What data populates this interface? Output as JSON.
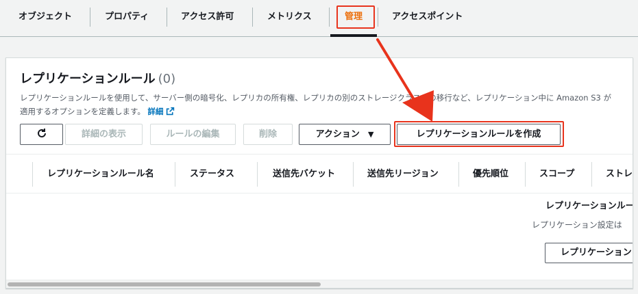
{
  "tabs": {
    "items": [
      {
        "label": "オブジェクト"
      },
      {
        "label": "プロパティ"
      },
      {
        "label": "アクセス許可"
      },
      {
        "label": "メトリクス"
      },
      {
        "label": "管理"
      },
      {
        "label": "アクセスポイント"
      }
    ],
    "active_index": 4
  },
  "panel": {
    "title": "レプリケーションルール",
    "count": "(0)",
    "description": "レプリケーションルールを使用して、サーバー側の暗号化、レプリカの所有権、レプリカの別のストレージクラスへの移行など、レプリケーション中に Amazon S3 が適用するオプションを定義します。",
    "details_link": "詳細",
    "external_link_icon": "external-link-icon"
  },
  "toolbar": {
    "refresh_icon": "refresh-icon",
    "view_details": "詳細の表示",
    "edit_rule": "ルールの編集",
    "delete": "削除",
    "actions": "アクション",
    "actions_caret": "▼",
    "create_rule": "レプリケーションルールを作成"
  },
  "table": {
    "columns": [
      "レプリケーションルール名",
      "ステータス",
      "送信先バケット",
      "送信先リージョン",
      "優先順位",
      "スコープ",
      "ストレ"
    ]
  },
  "empty_state": {
    "title": "レプリケーションルール",
    "description": "レプリケーション設定は",
    "button": "レプリケーション"
  },
  "colors": {
    "active_tab": "#ec7211",
    "link": "#0073bb",
    "annotation": "#e8331c"
  }
}
